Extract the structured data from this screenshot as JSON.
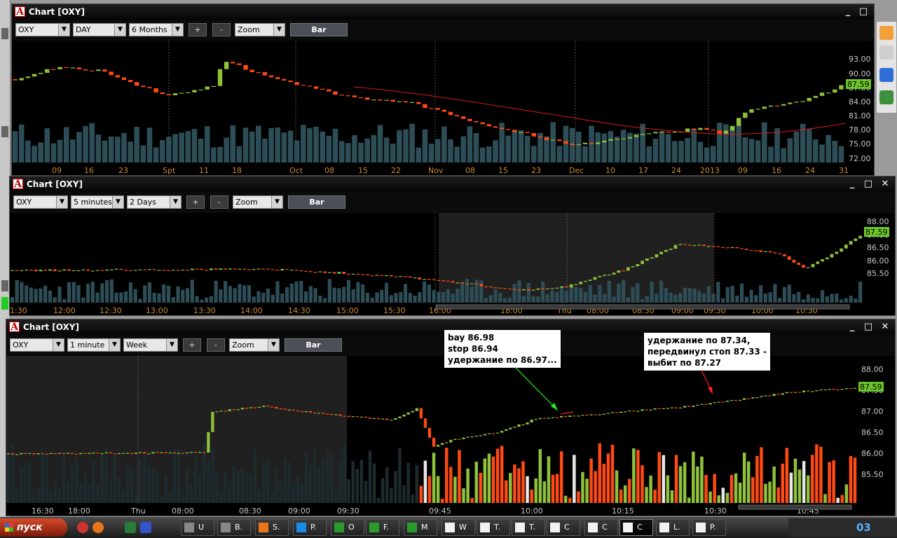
{
  "charts": [
    {
      "title": "Chart [OXY]",
      "symbol": "OXY",
      "interval": "DAY",
      "range": "6 Months",
      "zoom": "Zoom",
      "bar": "Bar",
      "plus": "+",
      "minus": "-",
      "last_price": "87.59",
      "price_ticks": [
        "93.00",
        "90.00",
        "87.00",
        "84.00",
        "81.00",
        "78.00",
        "75.00",
        "72.00"
      ],
      "time_ticks": [
        "09",
        "16",
        "23",
        "Spt",
        "11",
        "18",
        "Oct",
        "08",
        "15",
        "22",
        "Nov",
        "08",
        "15",
        "23",
        "Dec",
        "10",
        "17",
        "24",
        "2013",
        "09",
        "16",
        "24",
        "31"
      ]
    },
    {
      "title": "Chart [OXY]",
      "symbol": "OXY",
      "interval": "5 minutes",
      "range": "2 Days",
      "zoom": "Zoom",
      "bar": "Bar",
      "plus": "+",
      "minus": "-",
      "last_price": "87.59",
      "price_ticks": [
        "88.00",
        "87.00",
        "86.50",
        "86.00",
        "85.50"
      ],
      "time_ticks": [
        "1:30",
        "12:00",
        "12:30",
        "13:00",
        "13:30",
        "14:00",
        "14:30",
        "15:00",
        "15:30",
        "16:00",
        "18:00",
        "Thu",
        "08:00",
        "08:30",
        "09:00",
        "09:30",
        "10:00",
        "10:30"
      ]
    },
    {
      "title": "Chart [OXY]",
      "symbol": "OXY",
      "interval": "1 minute",
      "range": "Week",
      "zoom": "Zoom",
      "bar": "Bar",
      "plus": "+",
      "minus": "-",
      "last_price": "87.59",
      "price_ticks": [
        "88.00",
        "87.50",
        "87.00",
        "86.50",
        "86.00",
        "85.50"
      ],
      "time_ticks": [
        "16:30",
        "18:00",
        "Thu",
        "08:00",
        "08:30",
        "09:00",
        "09:30",
        "09:45",
        "10:00",
        "10:15",
        "10:30",
        "10:45"
      ]
    }
  ],
  "annotations": [
    {
      "text": "bay 86.98\nstop 86.94\nудержание по 86.97..."
    },
    {
      "text": "удержание по 87.34,\nпередвинул стоп 87.33 -\nвыбит по 87.27"
    }
  ],
  "taskbar": {
    "start": "пуск",
    "tasks": [
      "U",
      "B.",
      "S.",
      "P.",
      "O",
      "F.",
      "M",
      "W",
      "T.",
      "T.",
      "C",
      "C",
      "C",
      "L.",
      "P."
    ],
    "clock": "03"
  },
  "colors": {
    "up": "#8fc13a",
    "down": "#ff4a12",
    "volume": "#2e4e57",
    "price_axis": "#c8c8c8",
    "time_axis": "#c98a2c",
    "ma": "#d81b1b",
    "last_bg": "#6cc52a"
  }
}
